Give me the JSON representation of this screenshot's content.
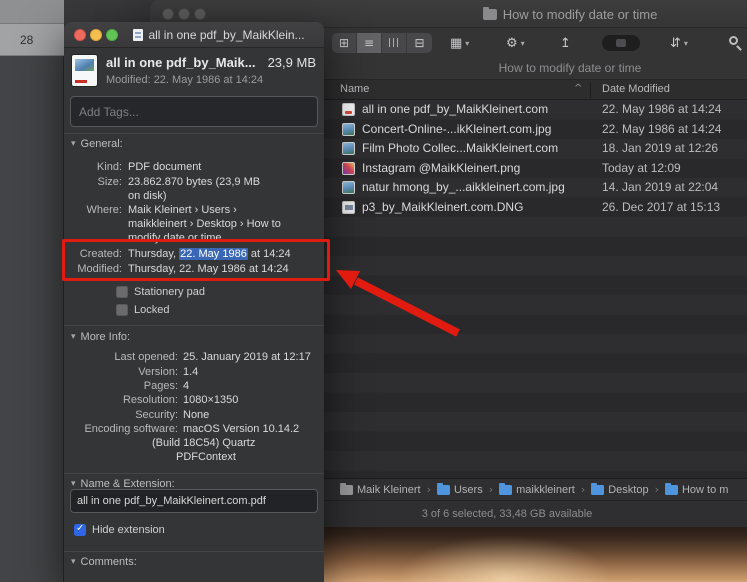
{
  "colors": {
    "annotation_red": "#e21b10",
    "selection_blue": "#3a67b6",
    "checkbox_blue": "#2e66e6"
  },
  "icons": {
    "disclosure": "▾",
    "chevron_down": "▾",
    "gear": "⚙",
    "grid_view": "⊞",
    "list_view": "≡",
    "column_view": "|||",
    "gallery_view": "⊟",
    "group_by": "▦",
    "share": "↥",
    "stack_arrows": "⇵",
    "sort_ascending": "^",
    "path_separator": "›",
    "checkmark": "✓"
  },
  "sidebar_fragment": {
    "day_number": "28"
  },
  "finder": {
    "window_title": "How to modify date or time",
    "toolbar_subtitle": "How to modify date or time",
    "list": {
      "columns": [
        {
          "label": "Name"
        },
        {
          "label": "Date Modified"
        }
      ],
      "files": [
        {
          "name": "all in one pdf_by_MaikKleinert.com",
          "date_modified": "22. May 1986 at 14:24"
        },
        {
          "name": "Concert-Online-...ikKleinert.com.jpg",
          "date_modified": "22. May 1986 at 14:24"
        },
        {
          "name": "Film Photo Collec...MaikKleinert.com",
          "date_modified": "18. Jan 2019 at 12:26"
        },
        {
          "name": "Instagram @MaikKleinert.png",
          "date_modified": "Today at 12:09"
        },
        {
          "name": "natur hmong_by_...aikkleinert.com.jpg",
          "date_modified": "14. Jan 2019 at 22:04"
        },
        {
          "name": "p3_by_MaikKleinert.com.DNG",
          "date_modified": "26. Dec 2017 at 15:13"
        }
      ]
    },
    "path_bar": [
      {
        "label": "Maik Kleinert"
      },
      {
        "label": "Users"
      },
      {
        "label": "maikkleinert"
      },
      {
        "label": "Desktop"
      },
      {
        "label": "How to m"
      }
    ],
    "status_bar": "3 of 6 selected, 33,48 GB available"
  },
  "info_window": {
    "window_title": "all in one pdf_by_MaikKlein...",
    "header": {
      "file_name": "all in one pdf_by_Maik...",
      "file_size": "23,9 MB",
      "modified": "Modified: 22. May 1986 at 14:24"
    },
    "tags_placeholder": "Add Tags...",
    "general": {
      "section_title": "General:",
      "kind_label": "Kind:",
      "kind_value": "PDF document",
      "size_label": "Size:",
      "size_value_line1": "23.862.870 bytes (23,9 MB",
      "size_value_line2": "on disk)",
      "where_label": "Where:",
      "where_line1": "Maik Kleinert › Users ›",
      "where_line2": "maikkleinert › Desktop › How to",
      "where_line3": "modify date or time",
      "created_label": "Created:",
      "created_prefix": "Thursday, ",
      "created_highlight": "22. May 1986",
      "created_suffix": " at 14:24",
      "modified_label": "Modified:",
      "modified_value": "Thursday, 22. May 1986 at 14:24",
      "stationery_label": "Stationery pad",
      "locked_label": "Locked"
    },
    "more_info": {
      "section_title": "More Info:",
      "last_opened_label": "Last opened:",
      "last_opened_value": "25. January 2019 at 12:17",
      "version_label": "Version:",
      "version_value": "1.4",
      "pages_label": "Pages:",
      "pages_value": "4",
      "resolution_label": "Resolution:",
      "resolution_value": "1080×1350",
      "security_label": "Security:",
      "security_value": "None",
      "encoding_label": "Encoding software:",
      "encoding_line1": "macOS Version 10.14.2",
      "encoding_line2": "(Build 18C54) Quartz",
      "encoding_line3": "PDFContext"
    },
    "name_extension": {
      "section_title": "Name & Extension:",
      "filename_value": "all in one pdf_by_MaikKleinert.com.pdf",
      "hide_extension_label": "Hide extension"
    },
    "comments": {
      "section_title": "Comments:"
    }
  }
}
